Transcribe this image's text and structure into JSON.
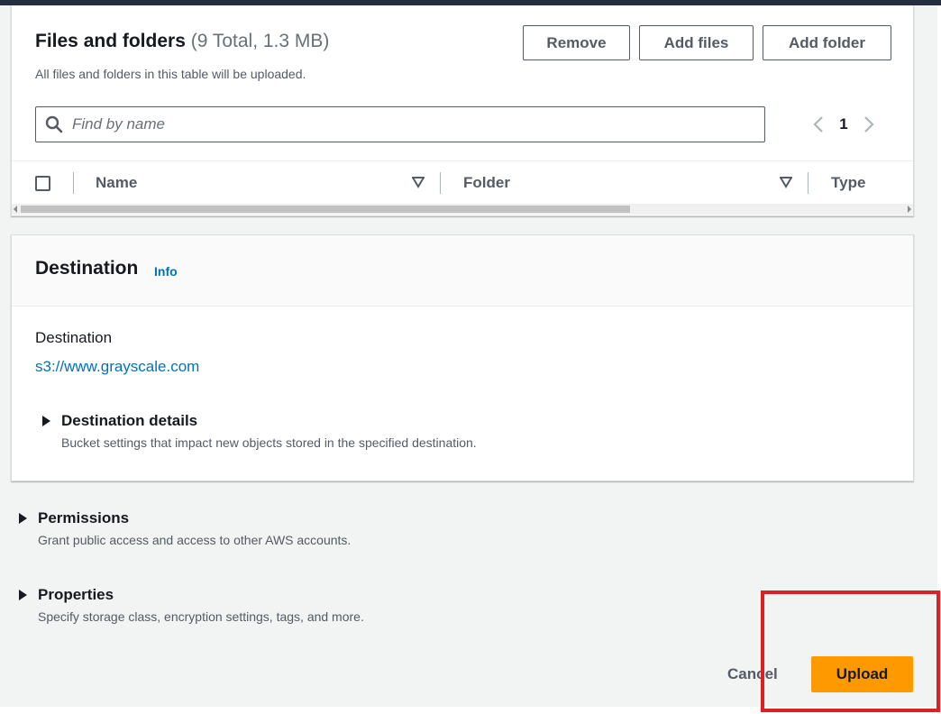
{
  "files": {
    "title": "Files and folders",
    "count": "(9 Total, 1.3 MB)",
    "description": "All files and folders in this table will be uploaded.",
    "buttons": {
      "remove": "Remove",
      "add_files": "Add files",
      "add_folder": "Add folder"
    },
    "search": {
      "placeholder": "Find by name",
      "icon": "search-icon"
    },
    "pagination": {
      "current_page": "1"
    },
    "columns": [
      "Name",
      "Folder",
      "Type"
    ]
  },
  "destination": {
    "title": "Destination",
    "info": "Info",
    "label": "Destination",
    "url": "s3://www.grayscale.com",
    "details": {
      "title": "Destination details",
      "description": "Bucket settings that impact new objects stored in the specified destination."
    }
  },
  "permissions": {
    "title": "Permissions",
    "description": "Grant public access and access to other AWS accounts."
  },
  "properties": {
    "title": "Properties",
    "description": "Specify storage class, encryption settings, tags, and more."
  },
  "actions": {
    "cancel": "Cancel",
    "upload": "Upload"
  },
  "colors": {
    "link": "#0073bb",
    "primary": "#ff9900",
    "highlight": "#e02020",
    "header": "#232f3e"
  }
}
